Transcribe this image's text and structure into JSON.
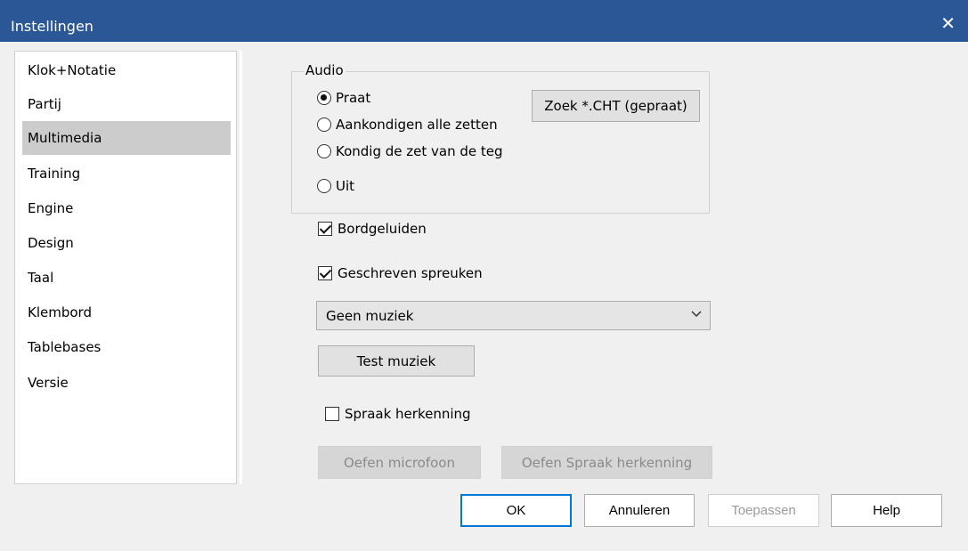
{
  "window": {
    "title": "Instellingen",
    "close_glyph": "✕"
  },
  "sidebar": {
    "items": [
      {
        "label": "Klok+Notatie"
      },
      {
        "label": "Partij"
      },
      {
        "label": "Multimedia"
      },
      {
        "label": "Training"
      },
      {
        "label": "Engine"
      },
      {
        "label": "Design"
      },
      {
        "label": "Taal"
      },
      {
        "label": "Klembord"
      },
      {
        "label": "Tablebases"
      },
      {
        "label": "Versie"
      }
    ],
    "selected": "Multimedia"
  },
  "audio": {
    "legend": "Audio",
    "options": [
      {
        "label": "Praat",
        "checked": true
      },
      {
        "label": "Aankondigen alle zetten",
        "checked": false
      },
      {
        "label": "Kondig de zet van de teg",
        "checked": false
      },
      {
        "label": "Uit",
        "checked": false
      }
    ],
    "search_button": "Zoek *.CHT (gepraat)"
  },
  "board_sounds": {
    "label": "Bordgeluiden",
    "checked": true
  },
  "written_sayings": {
    "label": "Geschreven spreuken",
    "checked": true
  },
  "music": {
    "selected": "Geen muziek",
    "test_button": "Test muziek"
  },
  "speech_recognition": {
    "label": "Spraak herkenning",
    "checked": false
  },
  "practice_mic_button": "Oefen microfoon",
  "practice_speech_button": "Oefen Spraak herkenning",
  "footer": {
    "ok": "OK",
    "cancel": "Annuleren",
    "apply": "Toepassen",
    "help": "Help"
  }
}
